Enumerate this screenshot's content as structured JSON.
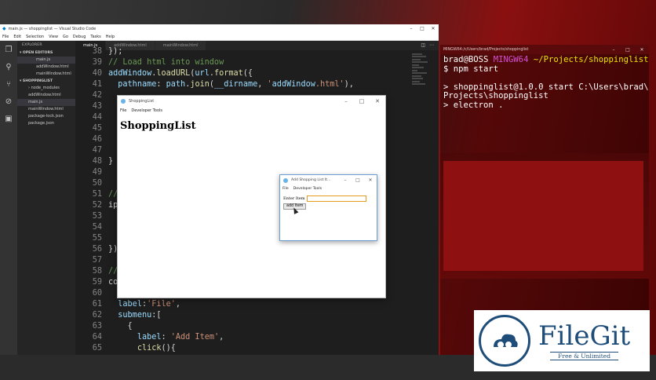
{
  "vscode": {
    "title": "main.js — shoppinglist — Visual Studio Code",
    "window_controls": [
      "–",
      "□",
      "✕"
    ],
    "menu": [
      "File",
      "Edit",
      "Selection",
      "View",
      "Go",
      "Debug",
      "Tasks",
      "Help"
    ],
    "sidebar": {
      "header": "EXPLORER",
      "open_editors_label": "OPEN EDITORS",
      "open_editors": [
        "main.js",
        "addWindow.html",
        "mainWindow.html"
      ],
      "project_label": "SHOPPINGLIST",
      "files": [
        "node_modules",
        "addWindow.html",
        "main.js",
        "mainWindow.html",
        "package-lock.json",
        "package.json"
      ]
    },
    "tabs": [
      "main.js",
      "addWindow.html",
      "mainWindow.html"
    ],
    "code_lines": [
      {
        "n": "38",
        "t": "});"
      },
      {
        "n": "39",
        "t": "// Load html into window"
      },
      {
        "n": "40",
        "t": "addWindow.loadURL(url.format({"
      },
      {
        "n": "41",
        "t": "  pathname: path.join(__dirname, 'addWindow.html'),"
      },
      {
        "n": "42",
        "t": ""
      },
      {
        "n": "43",
        "t": ""
      },
      {
        "n": "44",
        "t": ""
      },
      {
        "n": "45",
        "t": ""
      },
      {
        "n": "46",
        "t": ""
      },
      {
        "n": "47",
        "t": ""
      },
      {
        "n": "48",
        "t": "}"
      },
      {
        "n": "49",
        "t": ""
      },
      {
        "n": "50",
        "t": ""
      },
      {
        "n": "51",
        "t": "//"
      },
      {
        "n": "52",
        "t": "ip"
      },
      {
        "n": "53",
        "t": ""
      },
      {
        "n": "54",
        "t": ""
      },
      {
        "n": "55",
        "t": ""
      },
      {
        "n": "56",
        "t": "})"
      },
      {
        "n": "57",
        "t": ""
      },
      {
        "n": "58",
        "t": "//"
      },
      {
        "n": "59",
        "t": "co"
      },
      {
        "n": "60",
        "t": ""
      },
      {
        "n": "61",
        "t": "  label:'File',"
      },
      {
        "n": "62",
        "t": "  submenu:["
      },
      {
        "n": "63",
        "t": "    {"
      },
      {
        "n": "64",
        "t": "      label: 'Add Item',"
      },
      {
        "n": "65",
        "t": "      click(){"
      }
    ]
  },
  "shopping_window": {
    "title": "ShoppingList",
    "menu": [
      "File",
      "Developer Tools"
    ],
    "heading": "ShoppingList",
    "window_controls": [
      "–",
      "□",
      "✕"
    ]
  },
  "add_window": {
    "title": "Add Shopping List It...",
    "menu": [
      "File",
      "Developer Tools"
    ],
    "label": "Enter Item",
    "input_value": "",
    "button": "add Item",
    "window_controls": [
      "–",
      "□",
      "✕"
    ]
  },
  "terminal": {
    "title": "MINGW64:/c/Users/brad/Projects/shoppinglist",
    "window_controls": [
      "–",
      "□",
      "✕"
    ],
    "prompt_user": "brad@BOSS",
    "prompt_env": "MINGW64",
    "prompt_path": "~/Projects/shoppinglist",
    "command": "$ npm start",
    "output": [
      "> shoppinglist@1.0.0 start C:\\Users\\brad\\",
      "Projects\\shoppinglist",
      "> electron ."
    ]
  },
  "watermark": {
    "name": "FileGit",
    "tagline": "Free & Unlimited"
  },
  "colors": {
    "accent_orange": "#e39a1d",
    "vscode_bg": "#1e1e1e",
    "terminal_red": "#8e1010",
    "filegit_blue": "#1f4d7a"
  }
}
